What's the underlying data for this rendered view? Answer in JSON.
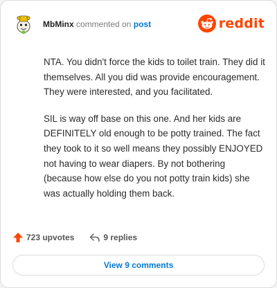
{
  "header": {
    "username": "MbMinx",
    "commented_on": "commented on",
    "post_link": "post",
    "brand_name": "reddit"
  },
  "comment": {
    "paragraphs": [
      "NTA. You didn't force the kids to toilet train. They did it themselves. All you did was provide encouragement. They were interested, and you facilitated.",
      "SIL is way off base on this one. And her kids are DEFINITELY old enough to be potty trained. The fact they took to it so well means they possibly ENJOYED not having to wear diapers. By not bothering (because how else do you not potty train kids) she was actually holding them back."
    ]
  },
  "actions": {
    "upvotes": "723 upvotes",
    "replies": "9 replies",
    "upvote_icon": "upvote-arrow-icon",
    "reply_icon": "reply-arrow-icon"
  },
  "footer": {
    "view_comments": "View 9 comments"
  },
  "colors": {
    "brand": "#ff4500",
    "link": "#0079d3",
    "muted": "#7c7c7c"
  }
}
